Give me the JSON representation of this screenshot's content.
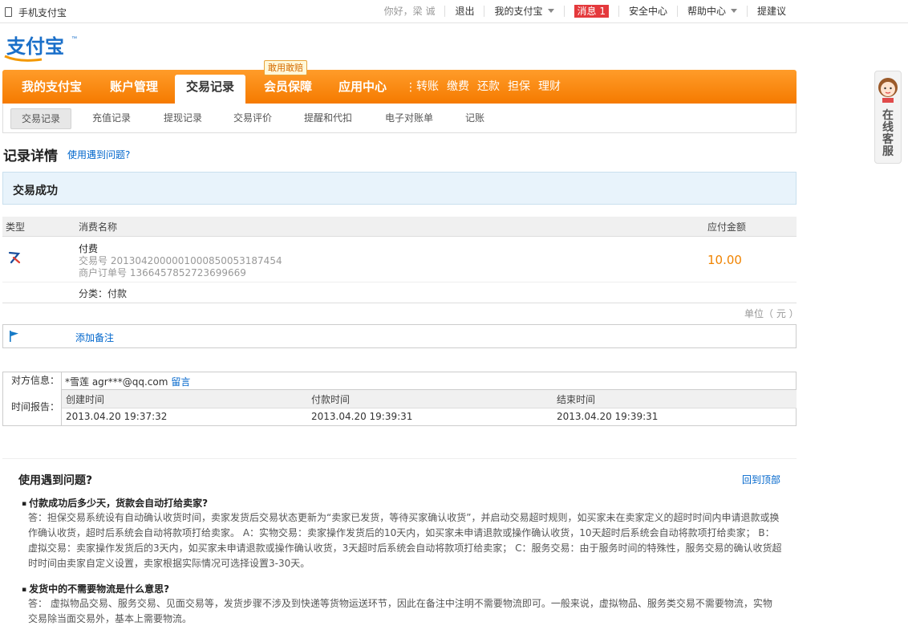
{
  "topbar": {
    "mobile": "手机支付宝",
    "greeting": "你好，梁 诚",
    "logout": "退出",
    "my_alipay": "我的支付宝",
    "messages_label": "消息 1",
    "security": "安全中心",
    "help": "帮助中心",
    "suggest": "提建议"
  },
  "logo": {
    "text": "支付宝",
    "tm": "™"
  },
  "nav": {
    "items": [
      "我的支付宝",
      "账户管理",
      "交易记录",
      "会员保障",
      "应用中心"
    ],
    "badge": "敢用敢赔",
    "quick_links": [
      "转账",
      "缴费",
      "还款",
      "担保",
      "理财"
    ]
  },
  "subnav": [
    "交易记录",
    "充值记录",
    "提现记录",
    "交易评价",
    "提醒和代扣",
    "电子对账单",
    "记账"
  ],
  "page": {
    "title": "记录详情",
    "help_link": "使用遇到问题?"
  },
  "status": "交易成功",
  "table": {
    "headers": {
      "type": "类型",
      "name": "消费名称",
      "amount": "应付金额"
    },
    "row": {
      "name": "付费",
      "trade_no": "交易号 2013042000001000850053187454",
      "order_no": "商户订单号 1366457852723699669",
      "amount": "10.00",
      "category": "分类：付款"
    },
    "unit": "单位（ 元 ）"
  },
  "remark": {
    "add": "添加备注"
  },
  "counterpart": {
    "label": "对方信息：",
    "value": "*雪莲 agr***@qq.com",
    "message_link": "留言"
  },
  "time_report": {
    "label": "时间报告：",
    "headers": [
      "创建时间",
      "付款时间",
      "结束时间"
    ],
    "values": [
      "2013.04.20 19:37:32",
      "2013.04.20 19:39:31",
      "2013.04.20 19:39:31"
    ]
  },
  "faq": {
    "title": "使用遇到问题?",
    "back_to_top": "回到顶部",
    "items": [
      {
        "q": "付款成功后多少天，货款会自动打给卖家?",
        "a_lines": [
          "答：担保交易系统设有自动确认收货时间，卖家发货后交易状态更新为“卖家已发货，等待买家确认收货”，并启动交易超时规则，如买家未在卖家定义的超时时间内申请退款或换",
          "作确认收货，超时后系统会自动将款项打给卖家。 A：实物交易：卖家操作发货后的10天内，如买家未申请退款或操作确认收货，10天超时后系统会自动将款项打给卖家； B：",
          "虚拟交易：卖家操作发货后的3天内，如买家未申请退款或操作确认收货，3天超时后系统会自动将款项打给卖家； C：服务交易：由于服务时间的特殊性，服务交易的确认收货超",
          "时时间由卖家自定义设置，卖家根据实际情况可选择设置3-30天。"
        ]
      },
      {
        "q": "发货中的不需要物流是什么意思?",
        "a_lines": [
          "答： 虚拟物品交易、服务交易、见面交易等，发货步骤不涉及到快递等货物运送环节，因此在备注中注明不需要物流即可。一般来说，虚拟物品、服务类交易不需要物流，实物",
          "交易除当面交易外，基本上需要物流。"
        ]
      }
    ]
  },
  "service": {
    "label": "在线客服"
  }
}
